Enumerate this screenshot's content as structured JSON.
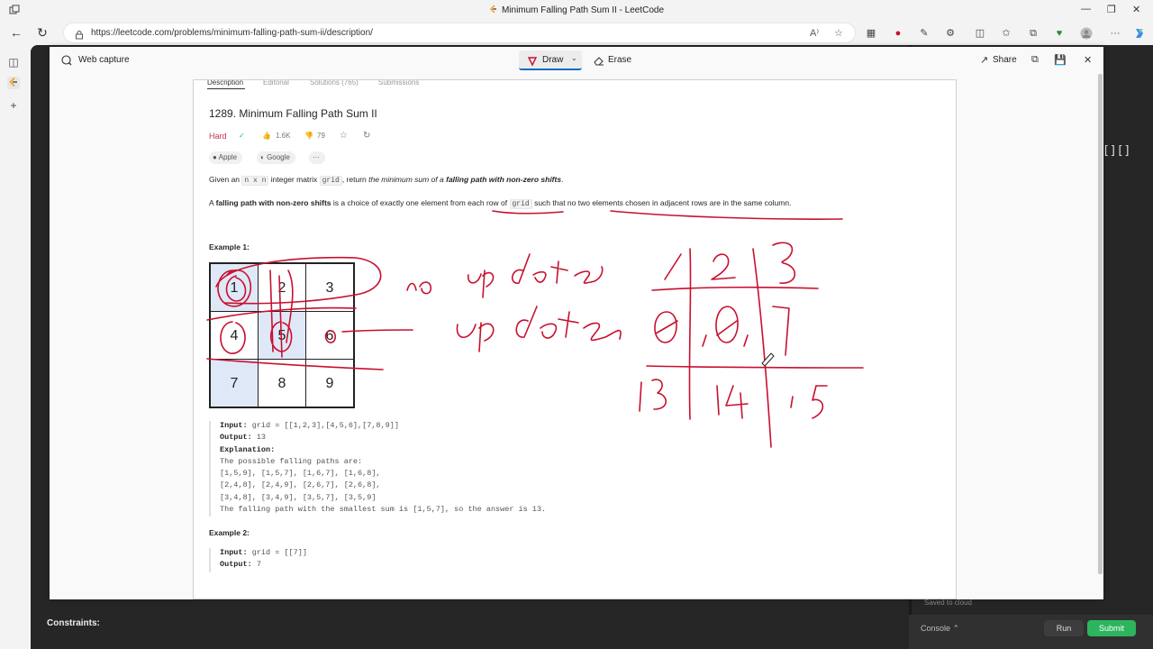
{
  "window": {
    "title": "Minimum Falling Path Sum II - LeetCode"
  },
  "browser": {
    "url_host": "https://leetcode.com",
    "url_path": "/problems/minimum-falling-path-sum-ii/description/"
  },
  "capture": {
    "title": "Web capture",
    "draw_label": "Draw",
    "erase_label": "Erase",
    "share_label": "Share"
  },
  "problem": {
    "tabs": [
      "Description",
      "Editorial",
      "Solutions (765)",
      "Submissions"
    ],
    "title": "1289. Minimum Falling Path Sum II",
    "difficulty": "Hard",
    "likes": "1.6K",
    "dislikes": "79",
    "companies": [
      "Apple",
      "Google"
    ],
    "more": "···",
    "para1": {
      "a": "Given an ",
      "code1": "n x n",
      "b": " integer matrix ",
      "code2": "grid",
      "c": ", return ",
      "em1": "the minimum sum of a ",
      "strong1": "falling path with non-zero shifts",
      "d": "."
    },
    "para2": {
      "a": "A ",
      "strong1": "falling path with non-zero shifts",
      "b": " is a choice of exactly one element from each row of ",
      "code1": "grid",
      "c": " such that no two elements chosen in adjacent rows are in the same column."
    },
    "example1_title": "Example 1:",
    "grid": [
      [
        "1",
        "2",
        "3"
      ],
      [
        "4",
        "5",
        "6"
      ],
      [
        "7",
        "8",
        "9"
      ]
    ],
    "example1_lines": [
      {
        "k": "Input:",
        "v": " grid = [[1,2,3],[4,5,6],[7,8,9]]"
      },
      {
        "k": "Output:",
        "v": " 13"
      },
      {
        "k": "Explanation:",
        "v": ""
      },
      {
        "k": "",
        "v": "The possible falling paths are:"
      },
      {
        "k": "",
        "v": "[1,5,9], [1,5,7], [1,6,7], [1,6,8],"
      },
      {
        "k": "",
        "v": "[2,4,8], [2,4,9], [2,6,7], [2,6,8],"
      },
      {
        "k": "",
        "v": "[3,4,8], [3,4,9], [3,5,7], [3,5,9]"
      },
      {
        "k": "",
        "v": "The falling path with the smallest sum is [1,5,7], so the answer is 13."
      }
    ],
    "example2_title": "Example 2:",
    "example2_lines": [
      {
        "k": "Input:",
        "v": " grid = [[7]]"
      },
      {
        "k": "Output:",
        "v": " 7"
      }
    ]
  },
  "background_page": {
    "constraints_label": "Constraints:",
    "saved_label": "Saved to cloud",
    "console_label": "Console ⌃",
    "run_label": "Run",
    "submit_label": "Submit",
    "brackets": "[][]"
  },
  "colors": {
    "accent": "#0f6cbd",
    "hard": "#c4314b",
    "ink": "#c8102e",
    "submit": "#2db55d"
  }
}
